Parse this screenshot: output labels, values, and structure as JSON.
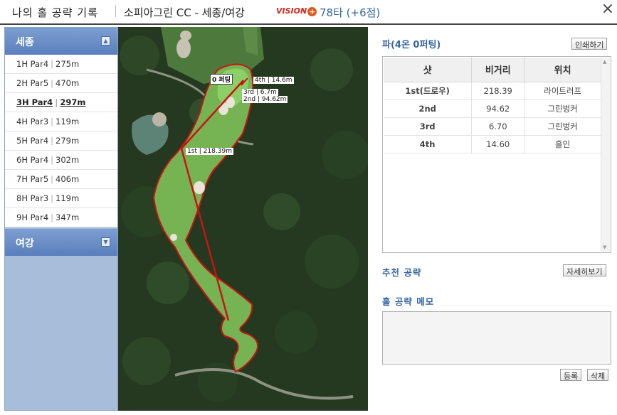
{
  "header": {
    "title": "나의 홀 공략 기록",
    "course": "소피아그린 CC - 세종/여강",
    "logo": "VISION",
    "score": "78타 (+6점)"
  },
  "sidebar": {
    "section1": "세종",
    "section2": "여강",
    "holes": [
      {
        "name": "1H Par4",
        "dist": "275m"
      },
      {
        "name": "2H Par5",
        "dist": "470m"
      },
      {
        "name": "3H Par4",
        "dist": "297m",
        "selected": true
      },
      {
        "name": "4H Par3",
        "dist": "119m"
      },
      {
        "name": "5H Par4",
        "dist": "279m"
      },
      {
        "name": "6H Par4",
        "dist": "302m"
      },
      {
        "name": "7H Par5",
        "dist": "406m"
      },
      {
        "name": "8H Par3",
        "dist": "119m"
      },
      {
        "name": "9H Par4",
        "dist": "347m"
      }
    ]
  },
  "map": {
    "labels": {
      "putt": "0 퍼팅",
      "fourth": "4th | 14.6m",
      "third": "3rd | 6.7m",
      "second": "2nd | 94.62m",
      "first": "1st | 218.39m"
    }
  },
  "panel": {
    "title": "파(4온 0퍼팅)",
    "print_btn": "인쇄하기",
    "columns": [
      "샷",
      "비거리",
      "위치"
    ],
    "rows": [
      {
        "shot": "1st(드로우)",
        "dist": "218.39",
        "loc": "라이트러프"
      },
      {
        "shot": "2nd",
        "dist": "94.62",
        "loc": "그린벙커"
      },
      {
        "shot": "3rd",
        "dist": "6.70",
        "loc": "그린벙커"
      },
      {
        "shot": "4th",
        "dist": "14.60",
        "loc": "홀인"
      }
    ],
    "recommend": "추천 공략",
    "detail_btn": "자세히보기",
    "memo_title": "홀 공략 메모",
    "memo_text": "",
    "register_btn": "등록",
    "delete_btn": "삭제"
  },
  "colors": {
    "accent": "#3465a4",
    "sidebar_bg": "#a8bdd9",
    "shot_line": "#c81414",
    "fairway": "#7dbf5c"
  }
}
